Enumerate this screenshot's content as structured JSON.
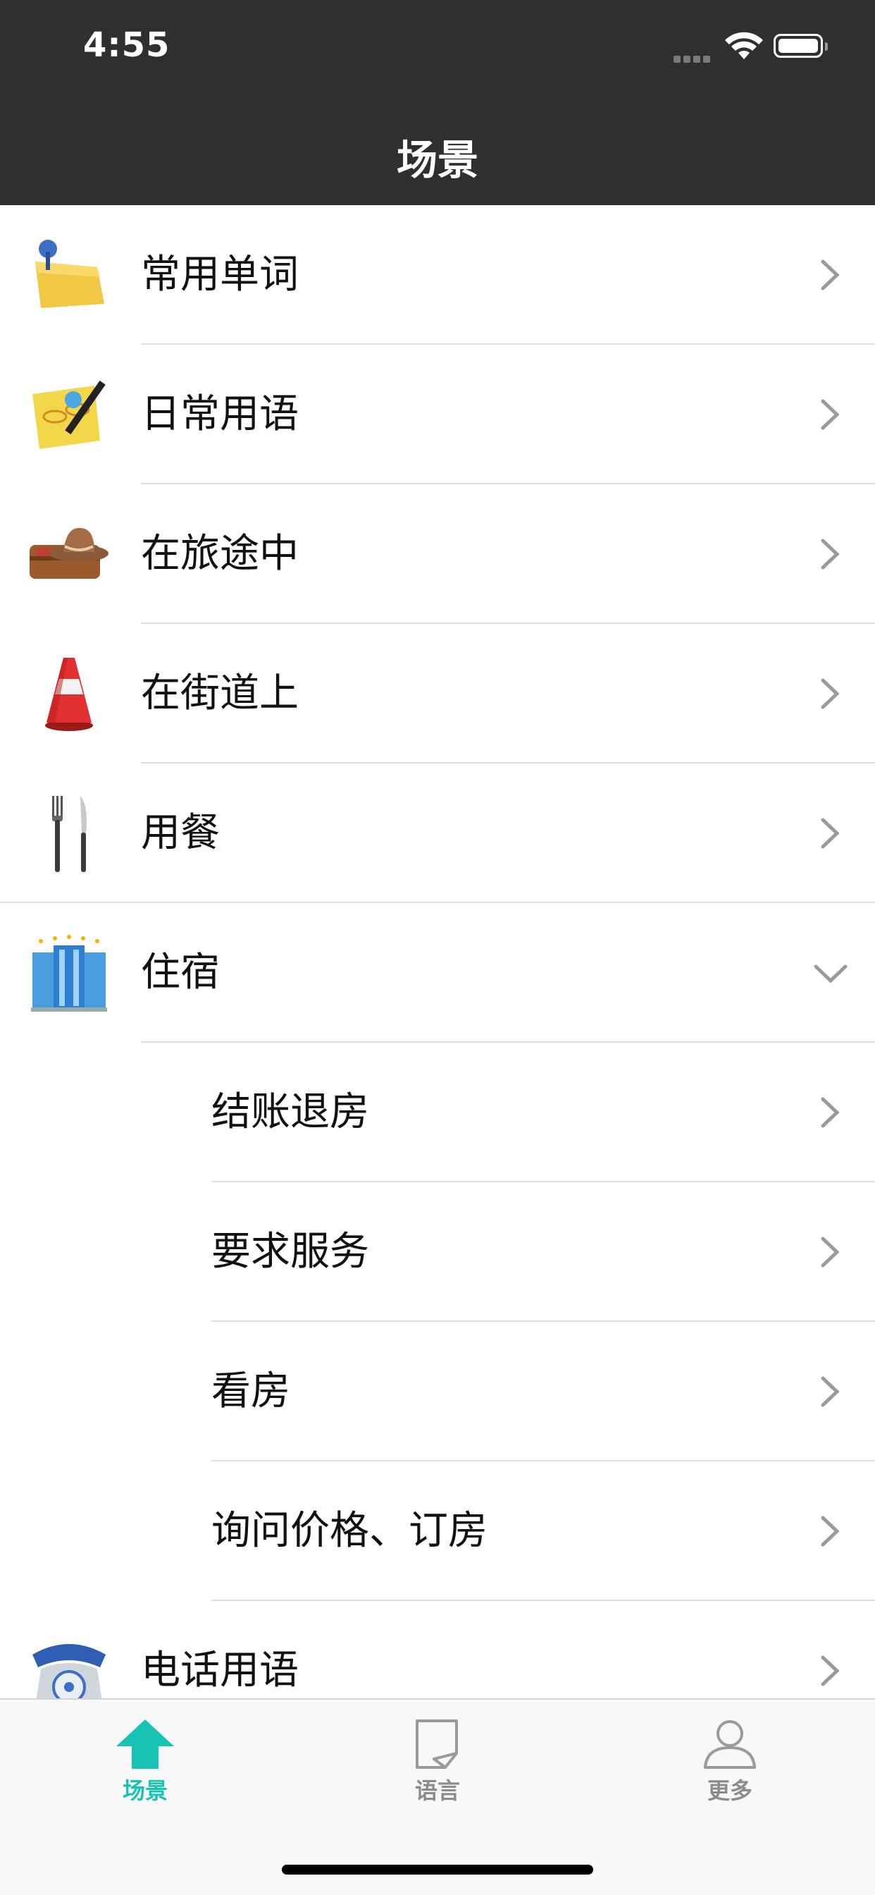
{
  "status_bar": {
    "time": "4:55"
  },
  "nav": {
    "title": "场景"
  },
  "rows": [
    {
      "label": "常用单词",
      "icon": "sticky-note-pin-icon",
      "state": "collapsed"
    },
    {
      "label": "日常用语",
      "icon": "notepad-pencil-icon",
      "state": "collapsed"
    },
    {
      "label": "在旅途中",
      "icon": "suitcase-hat-icon",
      "state": "collapsed"
    },
    {
      "label": "在街道上",
      "icon": "traffic-cone-icon",
      "state": "collapsed"
    },
    {
      "label": "用餐",
      "icon": "fork-knife-icon",
      "state": "collapsed"
    },
    {
      "label": "住宿",
      "icon": "hotel-building-icon",
      "state": "expanded",
      "children": [
        {
          "label": "结账退房"
        },
        {
          "label": "要求服务"
        },
        {
          "label": "看房"
        },
        {
          "label": "询问价格、订房"
        }
      ]
    },
    {
      "label": "电话用语",
      "icon": "telephone-icon",
      "state": "collapsed"
    }
  ],
  "tabbar": {
    "tabs": [
      {
        "label": "场景",
        "icon": "home-arrow-icon",
        "active": true
      },
      {
        "label": "语言",
        "icon": "book-icon",
        "active": false
      },
      {
        "label": "更多",
        "icon": "person-icon",
        "active": false
      }
    ]
  },
  "colors": {
    "accent": "#17c3b2",
    "header": "#2f2f2f",
    "separator": "#dedede"
  }
}
